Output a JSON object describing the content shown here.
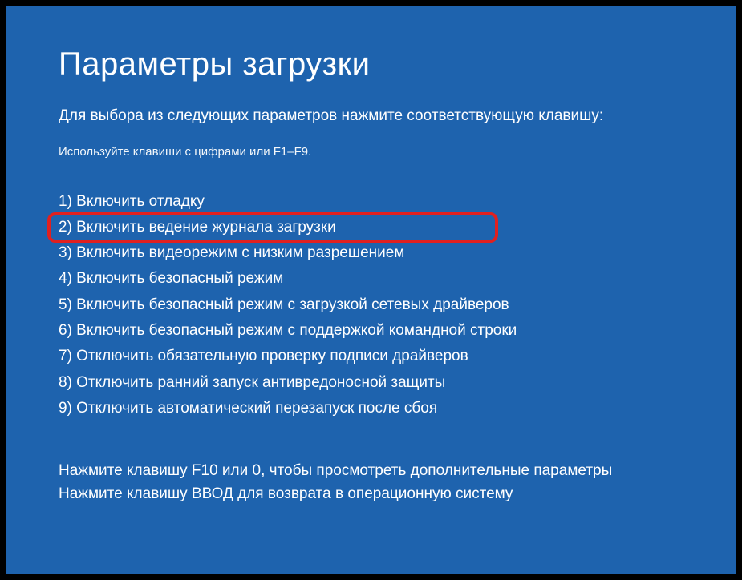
{
  "title": "Параметры загрузки",
  "instruction": "Для выбора из следующих параметров нажмите соответствующую клавишу:",
  "hint": "Используйте клавиши с цифрами или F1–F9.",
  "options": [
    "1) Включить отладку",
    "2) Включить ведение журнала загрузки",
    "3) Включить видеорежим с низким разрешением",
    "4) Включить безопасный режим",
    "5) Включить безопасный режим с загрузкой сетевых драйверов",
    "6) Включить безопасный режим с поддержкой командной строки",
    "7) Отключить обязательную проверку подписи драйверов",
    "8) Отключить ранний запуск антивредоносной защиты",
    "9) Отключить автоматический перезапуск после сбоя"
  ],
  "highlighted_index": 1,
  "footer": {
    "line1": "Нажмите клавишу F10 или 0, чтобы просмотреть дополнительные параметры",
    "line2": "Нажмите клавишу ВВОД для возврата в операционную систему"
  }
}
